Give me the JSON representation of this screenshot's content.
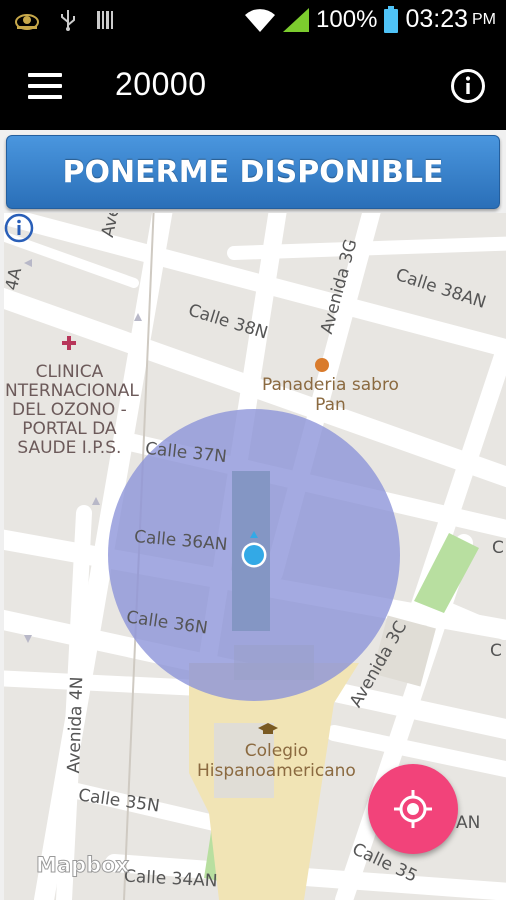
{
  "status_bar": {
    "battery": "100%",
    "time": "03:23",
    "ampm": "PM"
  },
  "app_bar": {
    "title": "20000"
  },
  "main": {
    "available_button": "PONERME DISPONIBLE"
  },
  "map": {
    "labels": {
      "avenida_top": "Avenida",
      "avenida_3g": "Avenida 3G",
      "calle_38an": "Calle 38AN",
      "calle_38n": "Calle 38N",
      "clinica": "CLINICA\nINTERNACIONAL\nDEL OZONO -\nPORTAL DA\nSAUDE I.P.S.",
      "panaderia": "Panaderia sabro\nPan",
      "calle_37n": "Calle 37N",
      "calle_36an": "Calle 36AN",
      "calle_36n": "Calle 36N",
      "avenida_3c": "Avenida 3C",
      "avenida_4n": "Avenida 4N",
      "colegio": "Colegio\nHispanoamericano",
      "calle_35n": "Calle 35N",
      "calle_34an": "Calle 34AN",
      "calle_35_partial": "Calle 35",
      "edge_a": "A",
      "edge_c1": "C",
      "edge_c2": "C",
      "edge_an": "AN",
      "edge_4a": "4A"
    },
    "attribution": "Mapbox"
  },
  "colors": {
    "fab": "#f2437a",
    "accuracy_circle": "#8a92d8",
    "location_dot": "#33a9e6"
  }
}
